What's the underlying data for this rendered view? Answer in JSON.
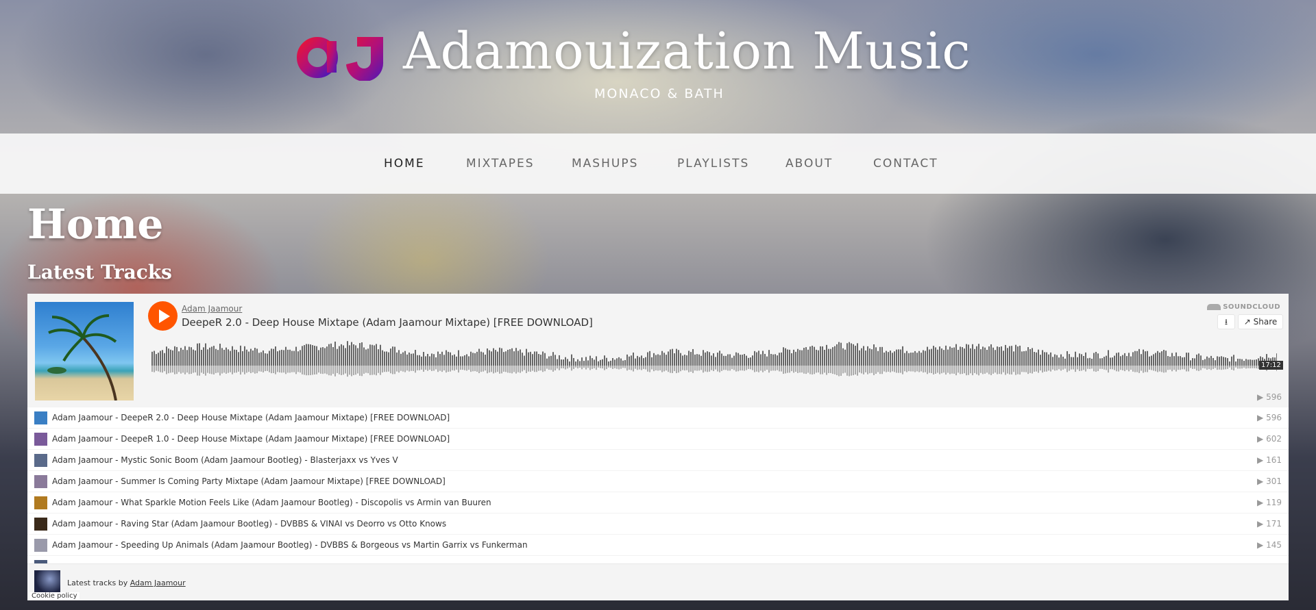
{
  "site": {
    "logo_text": "aJ",
    "title": "Adamouization Music",
    "subtitle": "MONACO & BATH"
  },
  "nav": {
    "items": [
      {
        "label": "HOME",
        "active": true
      },
      {
        "label": "MIXTAPES",
        "active": false
      },
      {
        "label": "MASHUPS",
        "active": false
      },
      {
        "label": "PLAYLISTS",
        "active": false
      },
      {
        "label": "ABOUT",
        "active": false
      },
      {
        "label": "CONTACT",
        "active": false
      }
    ]
  },
  "main": {
    "page_title": "Home",
    "section_title": "Latest Tracks"
  },
  "player": {
    "artist": "Adam Jaamour",
    "track_title": "DeepeR 2.0 - Deep House Mixtape (Adam Jaamour Mixtape) [FREE DOWNLOAD]",
    "brand": "SOUNDCLOUD",
    "share_label": "Share",
    "download_icon": "download-icon",
    "duration": "17:12",
    "plays": "596",
    "accent_color": "#ff5500"
  },
  "tracks": [
    {
      "title": "Adam Jaamour - DeepeR 2.0 - Deep House Mixtape (Adam Jaamour Mixtape) [FREE DOWNLOAD]",
      "plays": "596"
    },
    {
      "title": "Adam Jaamour - DeepeR 1.0 - Deep House Mixtape (Adam Jaamour Mixtape) [FREE DOWNLOAD]",
      "plays": "602"
    },
    {
      "title": "Adam Jaamour - Mystic Sonic Boom (Adam Jaamour Bootleg) - Blasterjaxx vs Yves V",
      "plays": "161"
    },
    {
      "title": "Adam Jaamour - Summer Is Coming Party Mixtape (Adam Jaamour Mixtape) [FREE DOWNLOAD]",
      "plays": "301"
    },
    {
      "title": "Adam Jaamour - What Sparkle Motion Feels Like (Adam Jaamour Bootleg) - Discopolis vs Armin van Buuren",
      "plays": "119"
    },
    {
      "title": "Adam Jaamour - Raving Star (Adam Jaamour Bootleg) - DVBBS & VINAI vs Deorro vs Otto Knows",
      "plays": "171"
    },
    {
      "title": "Adam Jaamour - Speeding Up Animals (Adam Jaamour Bootleg) - DVBBS & Borgeous vs Martin Garrix vs Funkerman",
      "plays": "145"
    },
    {
      "title": "",
      "plays": ""
    }
  ],
  "footer": {
    "prefix": "Latest tracks by",
    "link": "Adam Jaamour"
  },
  "cookie": "Cookie policy"
}
